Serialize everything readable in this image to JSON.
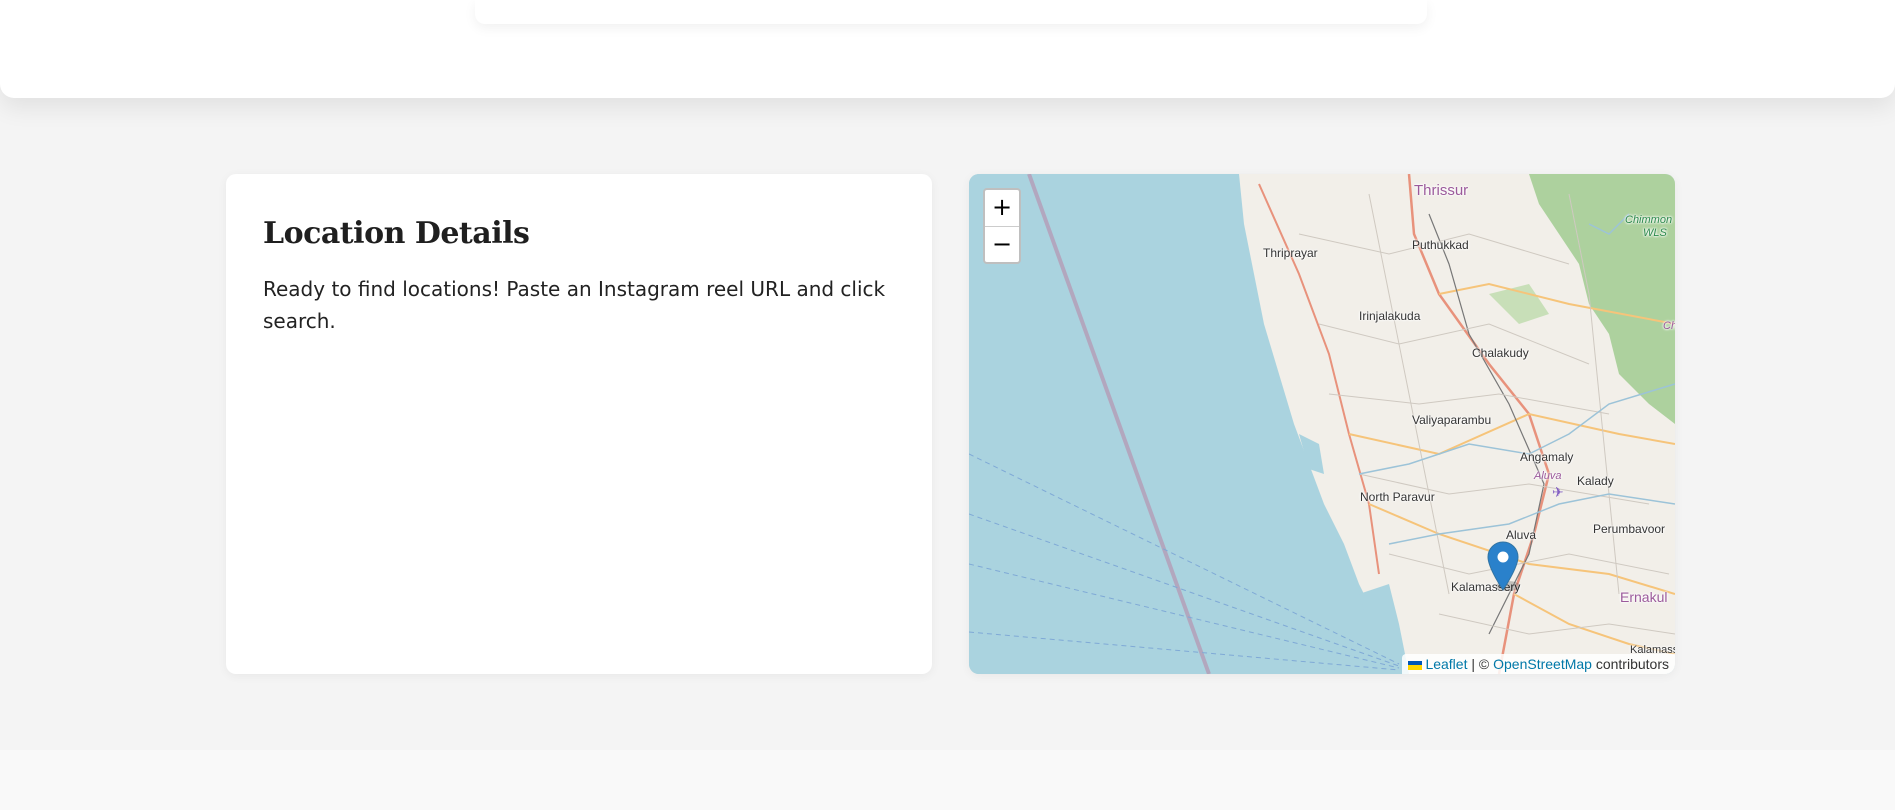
{
  "details": {
    "title": "Location Details",
    "message": "Ready to find locations! Paste an Instagram reel URL and click search."
  },
  "map": {
    "zoom_in": "+",
    "zoom_out": "−",
    "places": {
      "thrissur": "Thrissur",
      "thriprayar": "Thriprayar",
      "puthukkad": "Puthukkad",
      "irinjalakuda": "Irinjalakuda",
      "chalakudy": "Chalakudy",
      "valiyaparambu": "Valiyaparambu",
      "angamaly": "Angamaly",
      "aluva_river": "Aluva",
      "kalady": "Kalady",
      "north_paravur": "North Paravur",
      "aluva": "Aluva",
      "perumbavoor": "Perumbavoor",
      "kalamassery": "Kalamassery",
      "ernakulam": "Ernakul",
      "chimmoni": "Chimmon",
      "wls": "WLS",
      "ch": "Ch",
      "kalamassery_cut": "Kalamasser"
    },
    "attribution": {
      "leaflet": "Leaflet",
      "separator": " | © ",
      "osm": "OpenStreetMap",
      "contributors": " contributors"
    },
    "colors": {
      "sea": "#aad3df",
      "land": "#f2efe9",
      "forest": "#add19e",
      "marker": "#2a81cb"
    },
    "marker_icon": "map-pin-icon"
  }
}
